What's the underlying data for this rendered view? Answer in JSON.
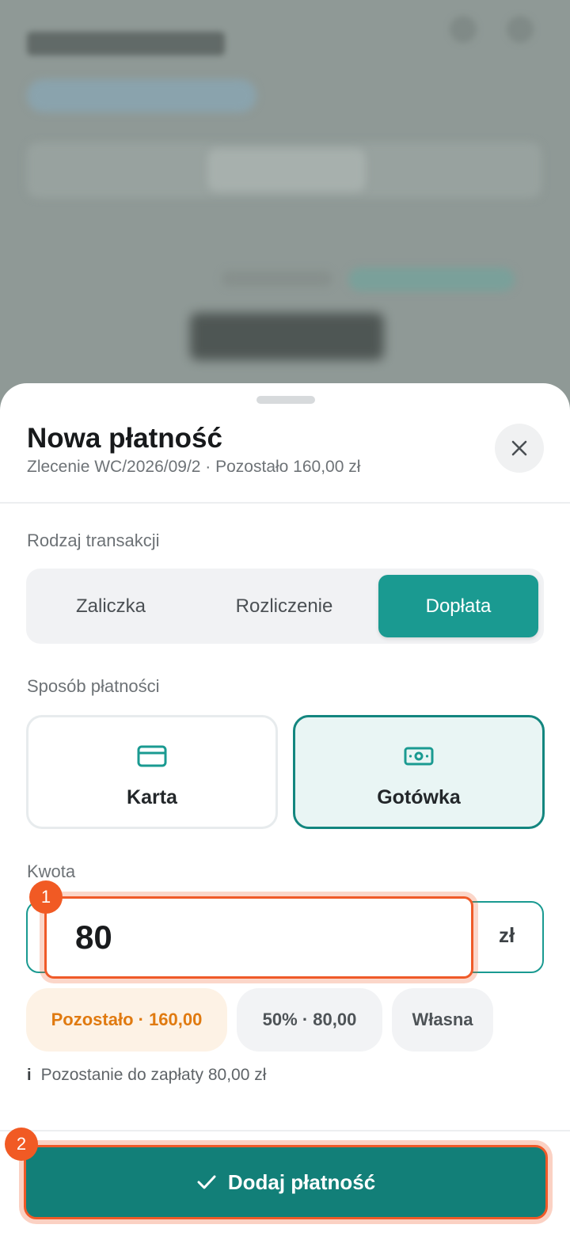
{
  "sheet": {
    "title": "Nowa płatność",
    "subtitle": "Zlecenie WC/2026/09/2 · Pozostało 160,00 zł"
  },
  "icons": {
    "close": "close-icon",
    "card": "credit-card-icon",
    "cash": "cash-icon",
    "check": "check-icon",
    "info": "info-icon"
  },
  "transaction_type": {
    "label": "Rodzaj transakcji",
    "options": [
      "Zaliczka",
      "Rozliczenie",
      "Dopłata"
    ],
    "selected": "Dopłata"
  },
  "payment_method": {
    "label": "Sposób płatności",
    "options": [
      "Karta",
      "Gotówka"
    ],
    "selected": "Gotówka"
  },
  "amount": {
    "label": "Kwota",
    "value": "80",
    "currency": "zł",
    "badge": "1"
  },
  "presets": [
    "Pozostało · 160,00",
    "50% · 80,00",
    "Własna"
  ],
  "info": {
    "icon_text": "i",
    "text": "Pozostanie do zapłaty 80,00 zł"
  },
  "submit": {
    "label": "Dodaj płatność",
    "badge": "2"
  },
  "colors": {
    "accent": "#1a9a91",
    "accent_dark": "#127f78",
    "highlight": "#ef5a28",
    "warning_text": "#e07a10",
    "warning_bg": "#fdf2e5"
  }
}
